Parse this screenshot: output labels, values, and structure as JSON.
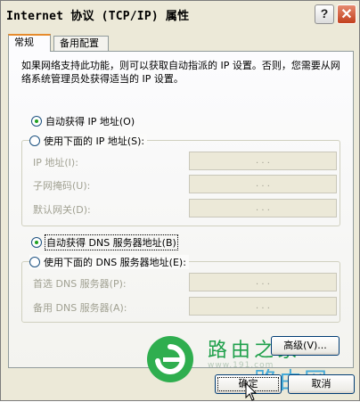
{
  "window": {
    "title": "Internet 协议 (TCP/IP) 属性",
    "help_glyph": "?",
    "close_glyph": "✕"
  },
  "tabs": [
    {
      "label": "常规",
      "active": true
    },
    {
      "label": "备用配置",
      "active": false
    }
  ],
  "description": "如果网络支持此功能，则可以获取自动指派的 IP 设置。否则，您需要从网络系统管理员处获得适当的 IP 设置。",
  "ip_section": {
    "auto_label": "自动获得 IP 地址(O)",
    "auto_selected": true,
    "manual_label": "使用下面的 IP 地址(S):",
    "fields": [
      {
        "label": "IP 地址(I):",
        "value": ". . ."
      },
      {
        "label": "子网掩码(U):",
        "value": ". . ."
      },
      {
        "label": "默认网关(D):",
        "value": ". . ."
      }
    ]
  },
  "dns_section": {
    "auto_label": "自动获得 DNS 服务器地址(B)",
    "auto_selected": true,
    "manual_label": "使用下面的 DNS 服务器地址(E):",
    "fields": [
      {
        "label": "首选 DNS 服务器(P):",
        "value": ". . ."
      },
      {
        "label": "备用 DNS 服务器(A):",
        "value": ". . ."
      }
    ]
  },
  "buttons": {
    "advanced": "高级(V)...",
    "ok": "确定",
    "cancel": "取消"
  },
  "watermark": {
    "text1": "路由之家",
    "text2": "路由网",
    "sub": "www.191.com"
  },
  "colors": {
    "window_bg": "#ece9d8",
    "active_tab_accent": "#e68b2c",
    "radio_dot": "#21a121",
    "close_button": "#c2401d"
  }
}
